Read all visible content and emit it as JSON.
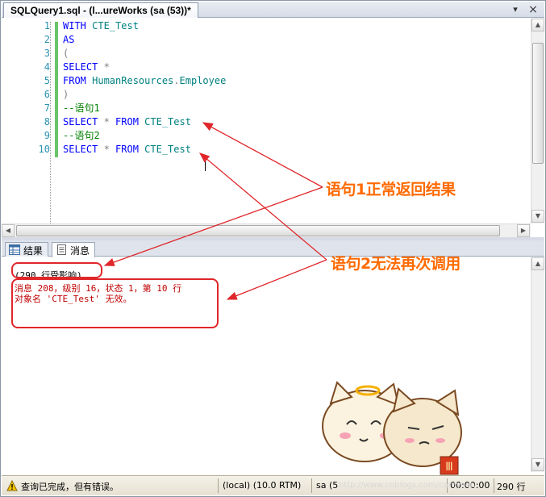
{
  "tab": {
    "title": "SQLQuery1.sql - (l...ureWorks (sa (53))*",
    "pin": "▾",
    "close": "×"
  },
  "editor": {
    "lines": [
      {
        "n": "1",
        "parts": [
          {
            "t": "WITH ",
            "c": "kw"
          },
          {
            "t": "CTE_Test",
            "c": "tx"
          }
        ]
      },
      {
        "n": "2",
        "parts": [
          {
            "t": "AS",
            "c": "kw"
          }
        ]
      },
      {
        "n": "3",
        "parts": [
          {
            "t": "(",
            "c": "gr"
          }
        ]
      },
      {
        "n": "4",
        "parts": [
          {
            "t": "SELECT ",
            "c": "kw"
          },
          {
            "t": "*",
            "c": "gr"
          }
        ]
      },
      {
        "n": "5",
        "parts": [
          {
            "t": "FROM ",
            "c": "kw"
          },
          {
            "t": "HumanResources",
            "c": "tx"
          },
          {
            "t": ".",
            "c": "gr"
          },
          {
            "t": "Employee",
            "c": "tx"
          }
        ]
      },
      {
        "n": "6",
        "parts": [
          {
            "t": ")",
            "c": "gr"
          }
        ]
      },
      {
        "n": "7",
        "parts": [
          {
            "t": "--语句1",
            "c": "cm"
          }
        ]
      },
      {
        "n": "8",
        "parts": [
          {
            "t": "SELECT ",
            "c": "kw"
          },
          {
            "t": "* ",
            "c": "gr"
          },
          {
            "t": "FROM ",
            "c": "kw"
          },
          {
            "t": "CTE_Test",
            "c": "tx"
          }
        ]
      },
      {
        "n": "9",
        "parts": [
          {
            "t": "--语句2",
            "c": "cm"
          }
        ]
      },
      {
        "n": "10",
        "parts": [
          {
            "t": "SELECT ",
            "c": "kw"
          },
          {
            "t": "* ",
            "c": "gr"
          },
          {
            "t": "FROM ",
            "c": "kw"
          },
          {
            "t": "CTE_Test",
            "c": "tx"
          }
        ]
      }
    ]
  },
  "results_tabs": {
    "results": "结果",
    "messages": "消息"
  },
  "messages": {
    "rows_affected": "(290 行受影响)",
    "error_line1": "消息 208，级别 16，状态 1，第 10 行",
    "error_line2": "对象名 'CTE_Test' 无效。"
  },
  "status": {
    "message": "查询已完成，但有错误。",
    "server": "(local) (10.0 RTM)",
    "user": "sa (5",
    "time": "00:00:00",
    "rows": "290 行"
  },
  "annotations": {
    "note1": "语句1正常返回结果",
    "note2": "语句2无法再次调用"
  },
  "watermark": "http://www.cnblogs.com/careyson",
  "colors": {
    "keyword": "#0000ff",
    "identifier": "#008080",
    "comment": "#008000",
    "error": "#c00000",
    "callout": "#ff6a00",
    "arrow": "#e0262a"
  }
}
